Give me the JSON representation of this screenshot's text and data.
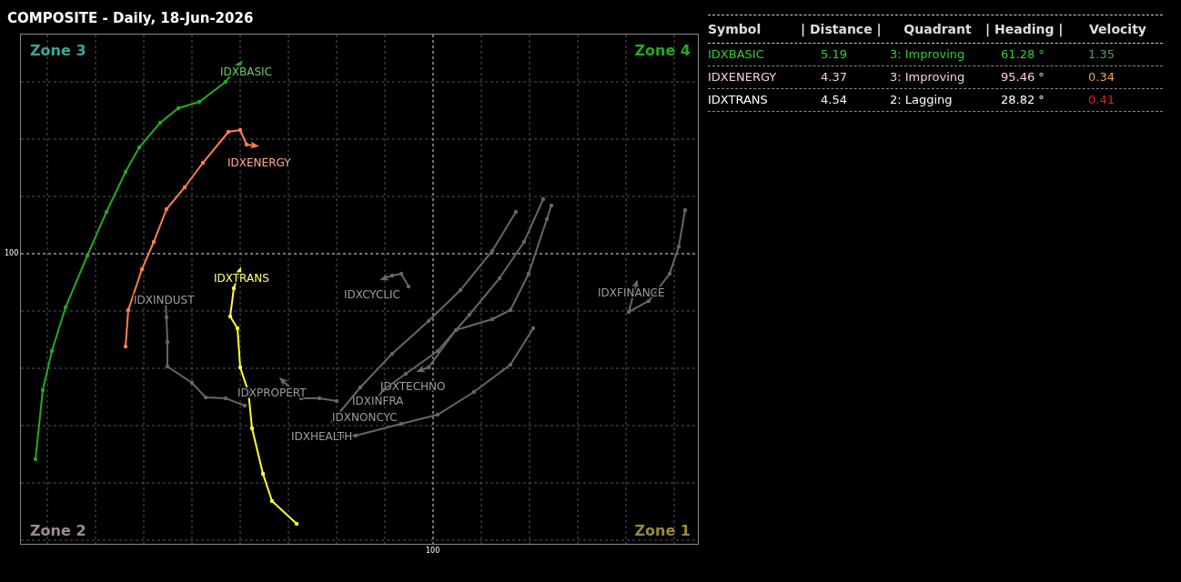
{
  "chart": {
    "title": "COMPOSITE - Daily, 18-Jun-2026",
    "zones": [
      {
        "label": "Zone 3",
        "color": "#3aa89a"
      },
      {
        "label": "Zone 4",
        "color": "#22aa22"
      },
      {
        "label": "Zone 2",
        "color": "#a08a8a"
      },
      {
        "label": "Zone 1",
        "color": "#9a8a3a"
      }
    ],
    "y_tick": "100",
    "x_tick": "100",
    "trails": [
      {
        "label": "IDXBASIC",
        "color": "#22aa22"
      },
      {
        "label": "IDXENERGY",
        "color": "#ff7f50"
      },
      {
        "label": "IDXTRANS",
        "color": "#ffff33"
      },
      {
        "label": "IDXINDUST",
        "color": "#666666"
      },
      {
        "label": "IDXCYCLIC",
        "color": "#666666"
      },
      {
        "label": "IDXFINANCE",
        "color": "#666666"
      },
      {
        "label": "IDXPROPERT",
        "color": "#666666"
      },
      {
        "label": "IDXTECHNO",
        "color": "#666666"
      },
      {
        "label": "IDXINFRA",
        "color": "#666666"
      },
      {
        "label": "IDXNONCYC",
        "color": "#666666"
      },
      {
        "label": "IDXHEALTH",
        "color": "#666666"
      }
    ]
  },
  "table": {
    "columns": [
      "Symbol",
      "| Distance |",
      "Quadrant",
      "| Heading |",
      "Velocity"
    ],
    "rows": [
      {
        "symbol": "IDXBASIC",
        "distance": "5.19",
        "quadrant": "3: Improving",
        "heading": "61.28 °",
        "velocity": {
          "text": "1.35",
          "color": "#5a9a6a"
        },
        "color": "#33cc33"
      },
      {
        "symbol": "IDXENERGY",
        "distance": "4.37",
        "quadrant": "3: Improving",
        "heading": "95.46 °",
        "velocity": {
          "text": "0.34",
          "color": "#f0a060"
        },
        "color": "#f5d0d0"
      },
      {
        "symbol": "IDXTRANS",
        "distance": "4.54",
        "quadrant": "2: Lagging",
        "heading": "28.82 °",
        "velocity": {
          "text": "0.41",
          "color": "#dd2222"
        },
        "color": "#ffffff"
      }
    ]
  }
}
